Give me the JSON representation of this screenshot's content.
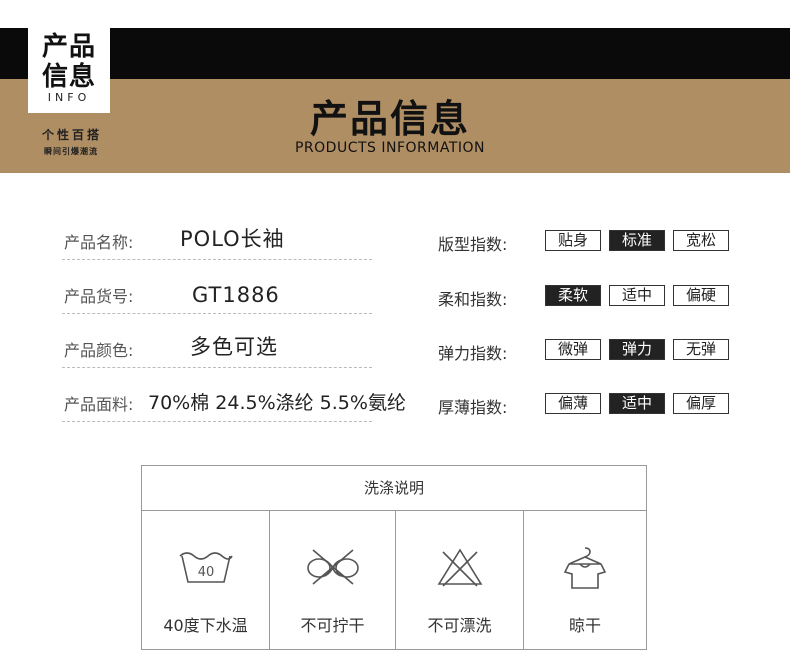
{
  "header": {
    "logo_line1": "产品",
    "logo_line2": "信息",
    "logo_sub": "INFO",
    "slogan": "个性百搭",
    "slogan_sub": "瞬间引爆潮流",
    "title": "产品信息",
    "subtitle": "PRODUCTS INFORMATION"
  },
  "info": [
    {
      "label": "产品名称:",
      "value": "POLO长袖"
    },
    {
      "label": "产品货号:",
      "value": "GT1886"
    },
    {
      "label": "产品颜色:",
      "value": "多色可选"
    },
    {
      "label": "产品面料:",
      "value": "70%棉 24.5%涤纶 5.5%氨纶"
    }
  ],
  "indices": [
    {
      "label": "版型指数:",
      "options": [
        "贴身",
        "标准",
        "宽松"
      ],
      "selected": 1
    },
    {
      "label": "柔和指数:",
      "options": [
        "柔软",
        "适中",
        "偏硬"
      ],
      "selected": 0
    },
    {
      "label": "弹力指数:",
      "options": [
        "微弹",
        "弹力",
        "无弹"
      ],
      "selected": 1
    },
    {
      "label": "厚薄指数:",
      "options": [
        "偏薄",
        "适中",
        "偏厚"
      ],
      "selected": 1
    }
  ],
  "care": {
    "title": "洗涤说明",
    "items": [
      {
        "icon": "wash-40-icon",
        "text": "40",
        "label": "40度下水温"
      },
      {
        "icon": "no-wring-icon",
        "label": "不可拧干"
      },
      {
        "icon": "no-bleach-icon",
        "label": "不可漂洗"
      },
      {
        "icon": "hang-dry-icon",
        "label": "晾干"
      }
    ]
  },
  "colors": {
    "banner_dark": "#0a0a0a",
    "banner_gold": "#b08e64",
    "selected_bg": "#222222"
  }
}
